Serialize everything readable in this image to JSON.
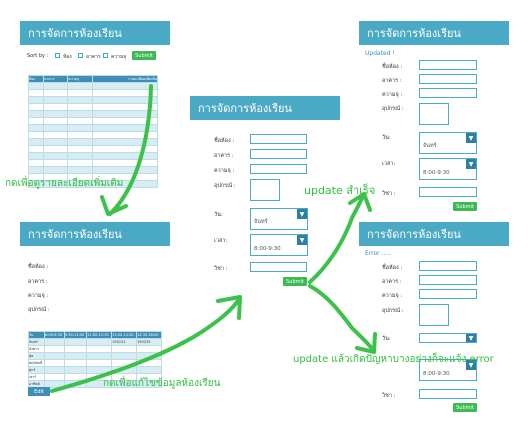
{
  "panel_title": "การจัดการห้องเรียน",
  "list_panel": {
    "sort_by_label": "Sort by :",
    "sort_options": [
      "ห้อง",
      "อาคาร",
      "ความจุ"
    ],
    "submit_label": "Submit",
    "table_headers": [
      "ห้อง",
      "อาคาร",
      "ความจุ",
      "รายละเอียดเพิ่มเติม"
    ]
  },
  "detail_panel": {
    "field_labels": [
      "ชื่อห้อง :",
      "อาคาร :",
      "ความจุ :",
      "อุปกรณ์ :"
    ],
    "schedule_headers": [
      "วัน",
      "8:00-9:30",
      "9:30-11:00",
      "11:00-12:30",
      "13:00-14:30",
      "14:30-16:00"
    ],
    "schedule_rows": [
      [
        "จันทร์",
        "",
        "",
        "",
        "190222",
        "190235"
      ],
      [
        "อังคาร",
        "",
        "",
        "",
        "",
        ""
      ],
      [
        "พุธ",
        "",
        "",
        "",
        "",
        ""
      ],
      [
        "พฤหัสบดี",
        "",
        "",
        "",
        "",
        ""
      ],
      [
        "ศุกร์",
        "",
        "",
        "",
        "",
        ""
      ],
      [
        "เสาร์",
        "",
        "",
        "",
        "",
        ""
      ],
      [
        "อาทิตย์",
        "",
        "",
        "",
        "",
        ""
      ]
    ],
    "edit_label": "Edit"
  },
  "edit_form": {
    "field_labels": [
      "ชื่อห้อง :",
      "อาคาร :",
      "ความจุ :",
      "อุปกรณ์ :"
    ],
    "day_label": "วัน:",
    "day_value": "จันทร์",
    "time_label": "เวลา:",
    "time_value": "8:00-9:30",
    "subject_label": "วิชา :",
    "submit_label": "Submit"
  },
  "success_panel": {
    "message": "Updated !"
  },
  "error_panel": {
    "message": "Error ....."
  },
  "annotations": {
    "more_details": "กดเพื่อดูรายละเอียดเพิ่มเติม",
    "edit_room": "กดเพื่อแก้ไขข้อมูลห้องเรียน",
    "update_success": "update สำเร็จ",
    "update_error": "update แล้วเกิดปัญหาบางอย่างก็จะแจ้ง error"
  },
  "colors": {
    "header": "#4aaac6",
    "accent": "#3d8fb8",
    "button": "#3cba54",
    "arrow": "#3cc24a"
  }
}
